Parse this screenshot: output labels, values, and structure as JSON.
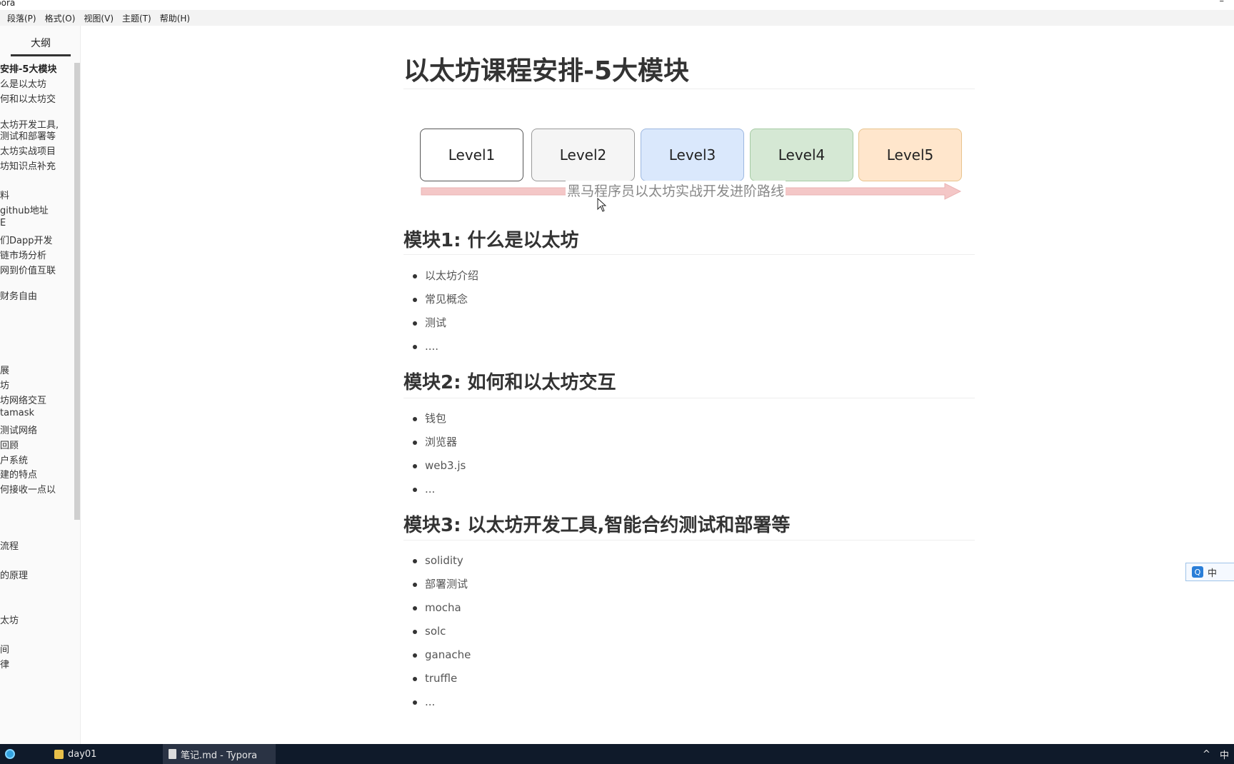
{
  "window": {
    "app_title_fragment": "pora",
    "minimize_glyph": "–"
  },
  "menu": {
    "items": [
      "段落(P)",
      "格式(O)",
      "视图(V)",
      "主题(T)",
      "帮助(H)"
    ]
  },
  "sidebar": {
    "tab_label": "大纲",
    "outline": [
      "安排-5大模块",
      "么是以太坊",
      "何和以太坊交",
      "太坊开发工具,",
      "测试和部署等",
      "太坊实战项目",
      "坊知识点补充",
      "料",
      "github地址",
      "E",
      "们Dapp开发",
      "链市场分析",
      "网到价值互联",
      "财务自由",
      "展",
      "坊",
      "坊网络交互",
      "tamask",
      "测试网络",
      "回顾",
      "户系统",
      "建的特点",
      "何接收一点以",
      "流程",
      "的原理",
      "太坊",
      "间",
      "律"
    ],
    "footer_icons": [
      "chevron-left-icon",
      "code-icon"
    ],
    "footer_glyphs": [
      "‹",
      "</>"
    ]
  },
  "document": {
    "title": "以太坊课程安排-5大模块",
    "figure": {
      "levels": [
        {
          "label": "Level1",
          "fill": "#ffffff",
          "border": "#555555"
        },
        {
          "label": "Level2",
          "fill": "#f5f5f5",
          "border": "#999999"
        },
        {
          "label": "Level3",
          "fill": "#dae8fc",
          "border": "#9db8e0"
        },
        {
          "label": "Level4",
          "fill": "#d5e8d4",
          "border": "#a6cba4"
        },
        {
          "label": "Level5",
          "fill": "#ffe6cc",
          "border": "#e8c48e"
        }
      ],
      "arrow_label": "黑马程序员以太坊实战开发进阶路线",
      "arrow_color": "#f4c7c7"
    },
    "sections": [
      {
        "heading": "模块1: 什么是以太坊",
        "items": [
          "以太坊介绍",
          "常见概念",
          "测试",
          "...."
        ]
      },
      {
        "heading": "模块2: 如何和以太坊交互",
        "items": [
          "钱包",
          "浏览器",
          "web3.js",
          "..."
        ]
      },
      {
        "heading": "模块3: 以太坊开发工具,智能合约测试和部署等",
        "items": [
          "solidity",
          "部署测试",
          "mocha",
          "solc",
          "ganache",
          "truffle",
          "..."
        ]
      }
    ]
  },
  "ime": {
    "icon": "Q",
    "mode": "中"
  },
  "taskbar": {
    "items": [
      {
        "label": "day01",
        "icon": "folder-icon"
      },
      {
        "label": "笔记.md - Typora",
        "icon": "typora-icon"
      }
    ],
    "tray_mode": "中"
  }
}
